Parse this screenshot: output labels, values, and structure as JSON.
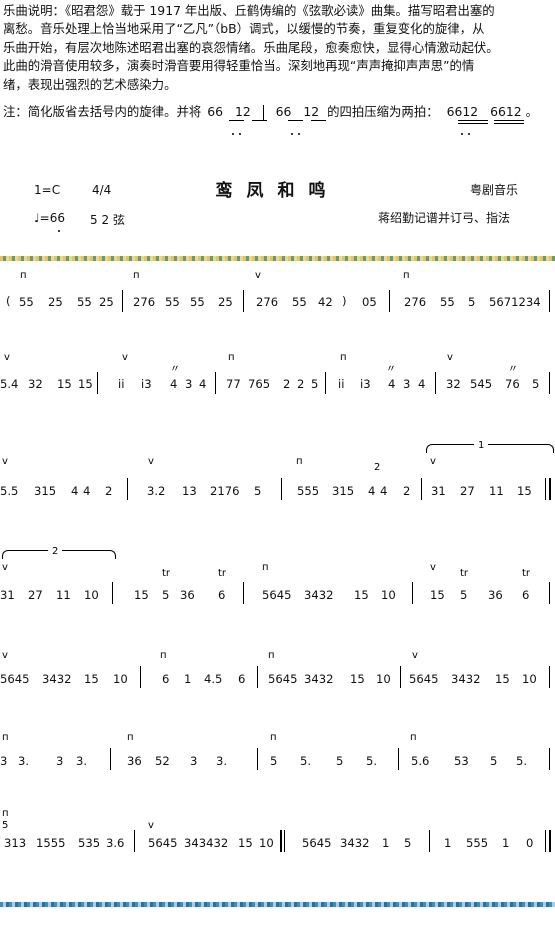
{
  "description": {
    "lines": [
      "乐曲说明：《昭君怨》载于 1917 年出版、丘鹤俦编的《弦歌必读》曲集。描写昭君出塞的",
      "离愁。音乐处理上恰当地采用了“乙凡”（bB）调式，以缓慢的节奏，重复变化的旋律，从",
      "乐曲开始，有层次地陈述昭君出塞的哀怨情绪。乐曲尾段，愈奏愈快，显得心情激动起伏。",
      "此曲的滑音使用较多，演奏时滑音要用得轻重恰当。深刻地再现“声声掩抑声声思”的情",
      "绪，表现出强烈的艺术感染力。"
    ],
    "note_prefix": "注：简化版省去括号内的旋律。并将",
    "note_a": "66",
    "note_b": "12",
    "note_c": "66",
    "note_d": "12",
    "note_mid": "的四拍压缩为两拍：",
    "note_e": "6612",
    "note_f": "6612",
    "note_end": "。"
  },
  "header": {
    "title": "鸾凤和鸣",
    "key": "1=C",
    "time": "4/4",
    "genre": "粤剧音乐",
    "tempo": "♩=66",
    "strings": "5 2 弦",
    "credit": "蒋绍勤记谱并订弓、指法"
  },
  "score": {
    "line1": [
      "(",
      "55",
      "25",
      "55",
      "25",
      "276",
      "55",
      "55",
      "25",
      "276",
      "55",
      "42",
      ")",
      "05",
      "276",
      "55",
      "5",
      "5671234"
    ],
    "line2": [
      "5.4",
      "32",
      "15",
      "15",
      "ii",
      "i3",
      "4",
      "3",
      "4",
      "77",
      "765",
      "2",
      "2",
      "5",
      "ii",
      "i3",
      "4",
      "3",
      "4",
      "32",
      "545",
      "76",
      "5"
    ],
    "line3": [
      "5.5",
      "315",
      "4",
      "4",
      "2",
      "3.2",
      "13",
      "2176",
      "5",
      "555",
      "315",
      "4",
      "4",
      "2",
      "31",
      "27",
      "11",
      "15"
    ],
    "line3_volta": "1",
    "line4": [
      "31",
      "27",
      "11",
      "10",
      "15",
      "5",
      "36",
      "6",
      "5645",
      "3432",
      "15",
      "10",
      "15",
      "5",
      "36",
      "6"
    ],
    "line4_volta": "2",
    "line4_tr": "tr",
    "line5": [
      "5645",
      "3432",
      "15",
      "10",
      "6",
      "1",
      "4.5",
      "6",
      "5645",
      "3432",
      "15",
      "10",
      "5645",
      "3432",
      "15",
      "10"
    ],
    "line6": [
      "3",
      "3.",
      "3",
      "3.",
      "36",
      "52",
      "3",
      "3.",
      "5",
      "5.",
      "5",
      "5.",
      "5.6",
      "53",
      "5",
      "5."
    ],
    "line7": [
      "5",
      "313",
      "1555",
      "535",
      "3.6",
      "5645",
      "343432",
      "15",
      "10",
      "5645",
      "3432",
      "1",
      "5",
      "1",
      "555",
      "1",
      "0"
    ],
    "bow_down": "п",
    "bow_up": "v",
    "slide": "〃",
    "finger": "2"
  }
}
